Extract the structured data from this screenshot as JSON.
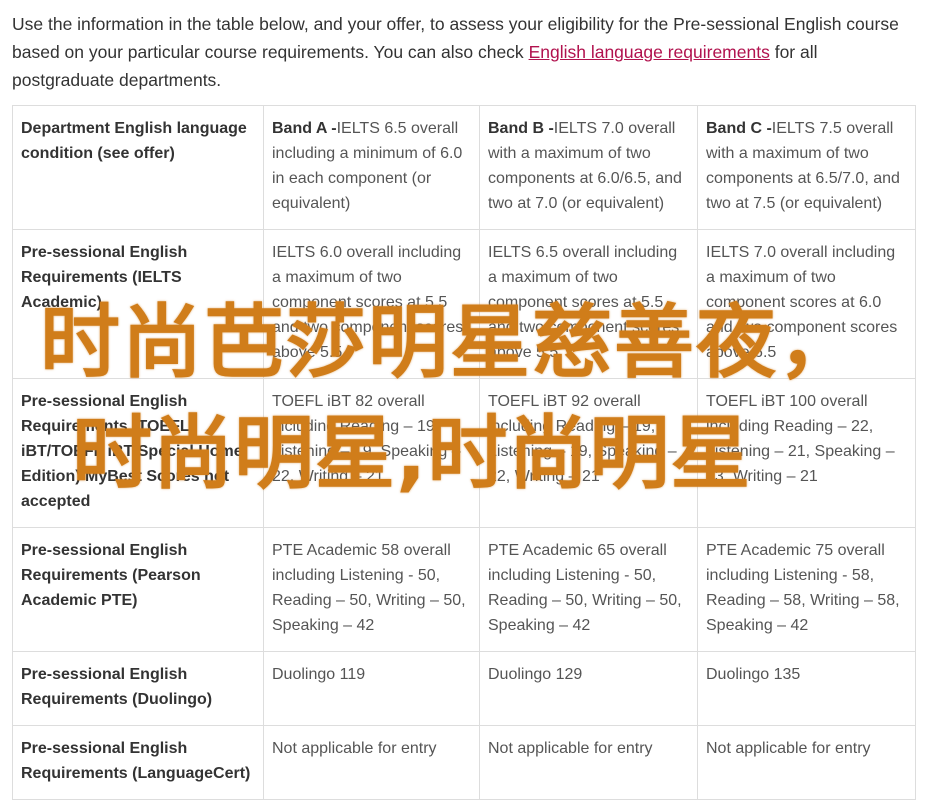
{
  "intro": {
    "text_before_link": "Use the information in the table below, and your offer, to assess your eligibility for the Pre-sessional English course based on your particular course requirements. You can also check ",
    "link_text": "English language requirements",
    "text_after_link": " for all postgraduate departments."
  },
  "table": {
    "header": {
      "col0": "Department English language condition (see offer)",
      "bands": [
        {
          "label": "Band A -",
          "text": "IELTS 6.5 overall including a minimum of 6.0 in each component (or equivalent)"
        },
        {
          "label": "Band B -",
          "text": "IELTS 7.0 overall with a maximum of two components at 6.0/6.5, and two at 7.0 (or equivalent)"
        },
        {
          "label": "Band C -",
          "text": "IELTS 7.5 overall with a maximum of two components at 6.5/7.0, and two at 7.5 (or equivalent)"
        }
      ]
    },
    "rows": [
      {
        "head": "Pre-sessional English Requirements (IELTS Academic)",
        "cells": [
          "IELTS 6.0 overall including a maximum of two component scores at 5.5 and two component scores above 5.5",
          "IELTS 6.5 overall including a maximum of two component scores at 5.5 and two component scores above 5.5",
          "IELTS 7.0 overall including a maximum of two component scores at 6.0 and two component scores above 6.5"
        ]
      },
      {
        "head": "Pre-sessional English Requirements (TOEFL iBT/TOEFL iBT Special Home Edition) MyBest Scores not accepted",
        "cells": [
          "TOEFL iBT 82 overall including Reading – 19, Listening – 19, Speaking – 22, Writing – 21",
          "TOEFL iBT 92 overall including Reading – 19, Listening – 19, Speaking – 22, Writing – 21",
          "TOEFL iBT 100 overall including Reading – 22, Listening – 21, Speaking – 23, Writing – 21"
        ]
      },
      {
        "head": "Pre-sessional English Requirements (Pearson Academic PTE)",
        "cells": [
          "PTE Academic 58 overall including Listening - 50, Reading – 50, Writing – 50, Speaking – 42",
          "PTE Academic 65 overall including Listening - 50, Reading – 50, Writing – 50, Speaking – 42",
          "PTE Academic 75 overall including Listening - 58, Reading – 58, Writing – 58, Speaking – 42"
        ]
      },
      {
        "head": "Pre-sessional English Requirements (Duolingo)",
        "cells": [
          "Duolingo 119",
          "Duolingo 129",
          "Duolingo 135"
        ]
      },
      {
        "head": "Pre-sessional English Requirements (LanguageCert)",
        "cells": [
          "Not applicable for entry",
          "Not applicable for entry",
          "Not applicable for entry"
        ]
      }
    ]
  },
  "watermark": {
    "line1": "时尚芭莎明星慈善夜，",
    "line2": "时尚明星,时尚明星"
  }
}
